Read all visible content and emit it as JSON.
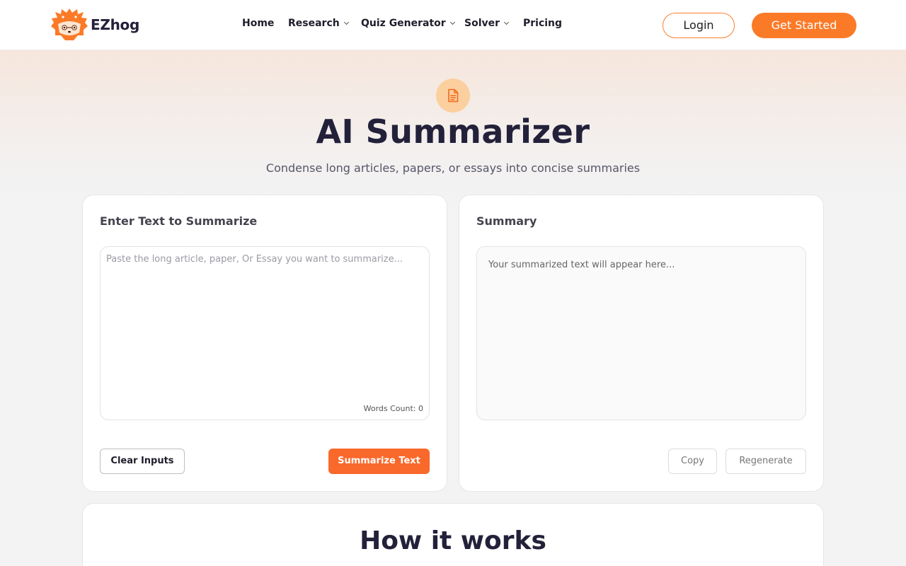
{
  "brand": {
    "name": "EZhog"
  },
  "nav": {
    "items": [
      {
        "label": "Home",
        "has_dropdown": false
      },
      {
        "label": "Research",
        "has_dropdown": true
      },
      {
        "label": "Quiz Generator",
        "has_dropdown": true
      },
      {
        "label": "Solver",
        "has_dropdown": true
      },
      {
        "label": "Pricing",
        "has_dropdown": false
      }
    ],
    "login_label": "Login",
    "get_started_label": "Get Started"
  },
  "hero": {
    "icon": "document-icon",
    "title": "AI Summarizer",
    "subtitle": "Condense long articles, papers, or essays into concise summaries"
  },
  "input_panel": {
    "title": "Enter Text to Summarize",
    "placeholder": "Paste the long article, paper, Or Essay you want to summarize...",
    "value": "",
    "word_count_label": "Words Count: 0",
    "clear_label": "Clear Inputs",
    "summarize_label": "Summarize Text"
  },
  "output_panel": {
    "title": "Summary",
    "placeholder": "Your summarized text will appear here...",
    "copy_label": "Copy",
    "regenerate_label": "Regenerate"
  },
  "how_it_works": {
    "title": "How it works"
  },
  "colors": {
    "accent": "#fb7a28",
    "accent_dark": "#f9692b",
    "text_dark": "#23213a",
    "icon_bg": "#fbcf9e"
  }
}
